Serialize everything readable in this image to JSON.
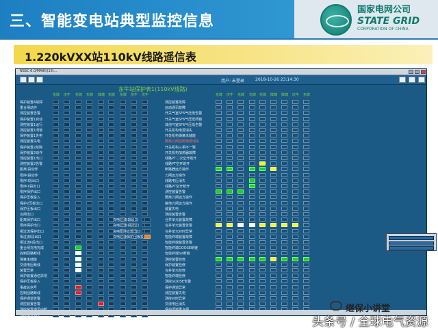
{
  "header": {
    "title": "三、智能变电站典型监控信息"
  },
  "logo": {
    "cn": "国家电网公司",
    "en": "STATE GRID",
    "sub": "CORPORATION OF CHINA"
  },
  "section": {
    "title": "1.220kVXX站110kV线路遥信表"
  },
  "window": {
    "title": "NSSC 6.0/MAIN/(16)...",
    "toolbar_user": "用户: 未登录",
    "toolbar_time": "2018-10-26 23:14:30",
    "panel_title": "东牛站保护表1(110kV线路)"
  },
  "columns_left": [
    "东牌",
    "庆牛",
    "东牌",
    "东牌",
    "牌端",
    "东牌",
    "东牌",
    "东牛",
    "庆牛",
    "西牌"
  ],
  "columns_right": [
    "东牌",
    "庆牛",
    "东牌",
    "东牌",
    "东牌",
    "牌端",
    "牌端",
    "庆牛",
    "东牌",
    "牌端"
  ],
  "rows_left": [
    "保护装置A故障",
    "重合闸动作",
    "测控装置告警",
    "保护装置1启动",
    "测控装置1运行",
    "测控装置1闭锁",
    "保护装置1失电",
    "测控装置失电",
    "保护装置2故障",
    "保护装置2动作",
    "测控装置1出口",
    "测控装置2告警",
    "距离I段动作",
    "零序I段动作",
    "零序II段出口",
    "零序III段出口",
    "零序保护出口",
    "保护压板投入",
    "保护2压板出口",
    "保护压板出口",
    "合闸出口",
    "距离保护出口",
    "零序保护出口",
    "相过流保护出口",
    "相过流I段出口",
    "相过流II段出口",
    "重合闸充电完成",
    "控制回路断线",
    "弹簧未储能",
    "交流电压断线",
    "装置异常",
    "保护装置通信异常",
    "保护压板投入",
    "事故总信号",
    "控制回路断线",
    "保护通道告警",
    "测控装置告警",
    "测控装置通讯中断",
    "测控装置通讯"
  ],
  "rows_mid": [
    "测控装置故障",
    "远动通讯故障",
    "开关气室SF6气压低告警",
    "开关气室SF6气压低闭锁",
    "其他气室SF6气压低告警",
    "开关机构电源消失",
    "开关机构弹簧未储能",
    "隔离刀闸控制电源消失",
    "开关机构三相不一致",
    "开关机构加热器故障",
    "线路PT二次空开跳开",
    "线路PT空开跳开",
    "断路器远方操作",
    "刀闸远方操作",
    "线路电压消失",
    "线路PT空开断开",
    "测控装置告警",
    "隔离刀闸远方操作",
    "接地刀闸远方操作",
    "装置失电",
    "测控装置告警",
    "合并单元装置故障",
    "合并单元装置告警",
    "合并单元对时异常",
    "智能终端装置故障",
    "智能终端装置告警",
    "智能终端GOOSE断链",
    "智能终端SV断链",
    "测控装置检修",
    "保护装置检修",
    "合并单元检修",
    "智能终端检修",
    "测控GOOSE告警",
    "保护通道异常",
    "测控装置失电",
    "测控对时异常",
    "交流电压消失",
    "保护闭锁重合闸",
    "保护装置运行",
    "保护PT断线",
    "保护CT断线",
    "保护装置异常",
    "保护装置检修投入",
    "保护GOOSE告警",
    "保护SV告警"
  ],
  "rows_mid2": [
    "充电过流I段出口",
    "充电过流II段出口",
    "充电零序过流出口",
    "充电过流保护压板投入"
  ],
  "legend_colors": {
    "on": "#1fd11f",
    "warn": "#f5f52a",
    "trip": "#e31d1d",
    "closed": "#ffffff",
    "off": "#1b4f77"
  },
  "watermark": {
    "line1": "继保小讲堂",
    "line2": "头条号 / 全球电气资源"
  }
}
